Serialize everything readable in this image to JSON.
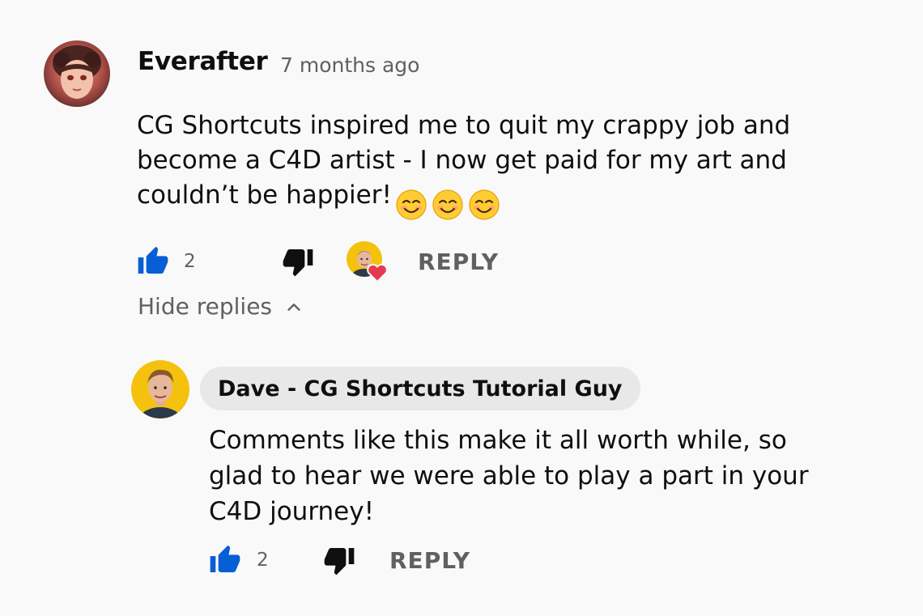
{
  "comment": {
    "author": "Everafter",
    "timestamp": "7 months ago",
    "body_lines": [
      "CG Shortcuts inspired me to quit my crappy job and",
      "become a C4D artist - I now get paid for my art and",
      "couldn’t be happier!"
    ],
    "emoji": [
      "smiling-face-with-smiling-eyes",
      "smiling-face-with-smiling-eyes",
      "smiling-face-with-smiling-eyes"
    ],
    "like_count": "2",
    "reply_label": "REPLY",
    "hearted_by_creator": true
  },
  "replies_toggle": {
    "label": "Hide replies",
    "icon": "chevron-up-icon"
  },
  "reply": {
    "author": "Dave - CG Shortcuts Tutorial Guy",
    "body_lines": [
      "Comments like this make it all worth while, so",
      "glad to hear we were able to play a part in your",
      "C4D journey!"
    ],
    "like_count": "2",
    "reply_label": "REPLY"
  },
  "colors": {
    "background": "#f9f9f9",
    "text_primary": "#0f0f0f",
    "text_secondary": "#606060",
    "like_active": "#065fd4",
    "heart": "#e53950",
    "author_chip": "#e8e8e8"
  }
}
